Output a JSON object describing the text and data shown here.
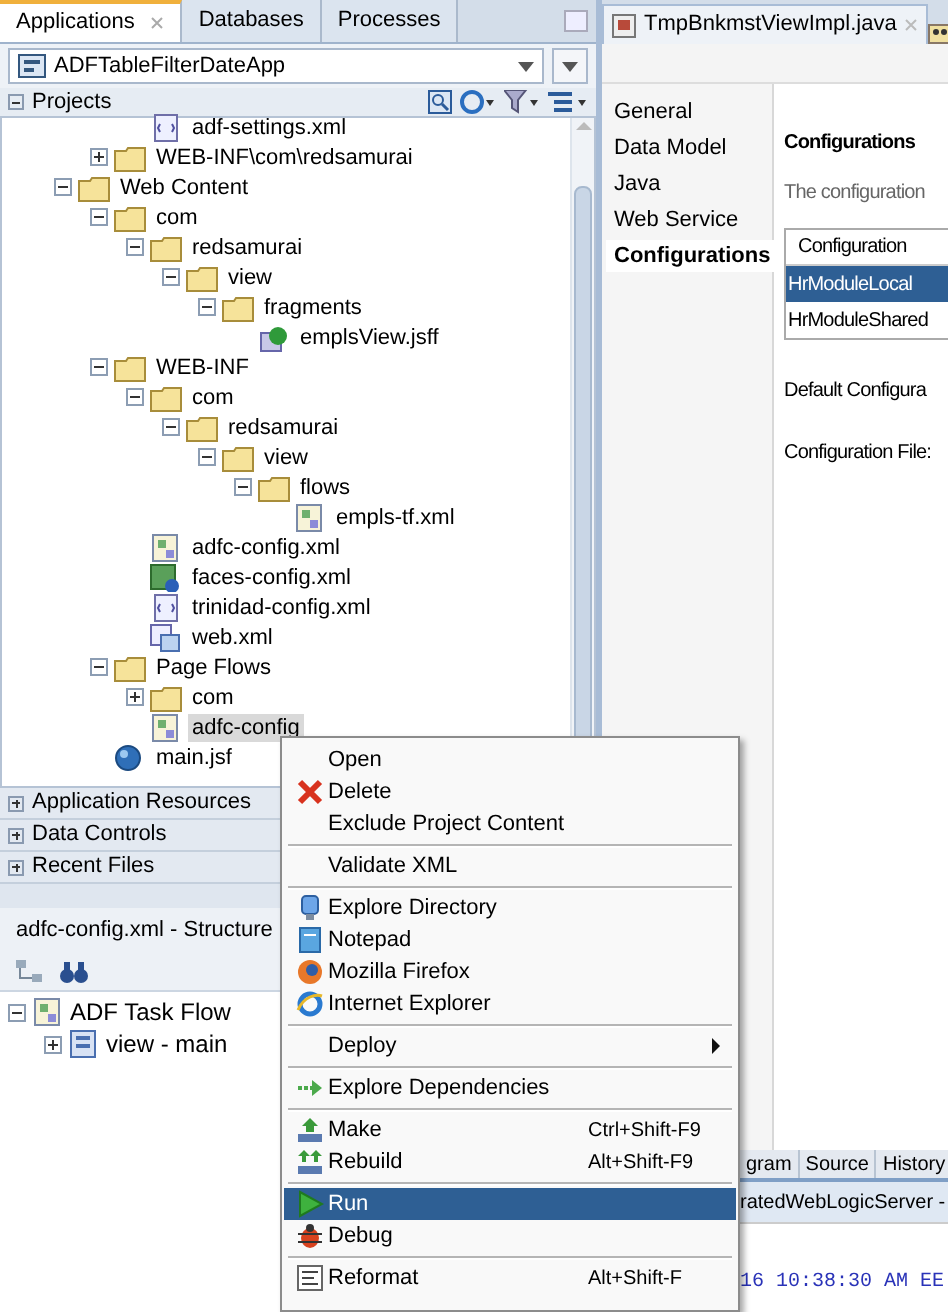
{
  "left_tabs": [
    {
      "label": "Applications",
      "selected": true,
      "closable": true
    },
    {
      "label": "Databases",
      "selected": false,
      "closable": false
    },
    {
      "label": "Processes",
      "selected": false,
      "closable": false
    }
  ],
  "application_selector": {
    "value": "ADFTableFilterDateApp"
  },
  "projects_header": {
    "label": "Projects",
    "expanded": true
  },
  "project_tree": [
    {
      "kind": "branch",
      "children": [
        {
          "kind": "branch",
          "children": [
            {
              "kind": "xml",
              "label": "adf-settings.xml",
              "selected": false
            }
          ]
        },
        {
          "kind": "folder",
          "label": "WEB-INF\\com\\redsamurai",
          "expanded": false,
          "selected": false
        }
      ]
    },
    {
      "kind": "folder",
      "label": "Web Content",
      "expanded": true,
      "selected": false,
      "children": [
        {
          "kind": "folder",
          "label": "com",
          "expanded": true,
          "selected": false,
          "children": [
            {
              "kind": "folder",
              "label": "redsamurai",
              "expanded": true,
              "selected": false,
              "children": [
                {
                  "kind": "folder",
                  "label": "view",
                  "expanded": true,
                  "selected": false,
                  "children": [
                    {
                      "kind": "folder",
                      "label": "fragments",
                      "expanded": true,
                      "selected": false,
                      "children": [
                        {
                          "kind": "page",
                          "label": "emplsView.jsff",
                          "selected": false
                        }
                      ]
                    }
                  ]
                }
              ]
            }
          ]
        },
        {
          "kind": "folder",
          "label": "WEB-INF",
          "expanded": true,
          "selected": false,
          "children": [
            {
              "kind": "folder",
              "label": "com",
              "expanded": true,
              "selected": false,
              "children": [
                {
                  "kind": "folder",
                  "label": "redsamurai",
                  "expanded": true,
                  "selected": false,
                  "children": [
                    {
                      "kind": "folder",
                      "label": "view",
                      "expanded": true,
                      "selected": false,
                      "children": [
                        {
                          "kind": "folder",
                          "label": "flows",
                          "expanded": true,
                          "selected": false,
                          "children": [
                            {
                              "kind": "flow",
                              "label": "empls-tf.xml",
                              "selected": false
                            }
                          ]
                        }
                      ]
                    }
                  ]
                }
              ]
            },
            {
              "kind": "flow",
              "label": "adfc-config.xml",
              "selected": false
            },
            {
              "kind": "faces",
              "label": "faces-config.xml",
              "selected": false
            },
            {
              "kind": "xml",
              "label": "trinidad-config.xml",
              "selected": false
            },
            {
              "kind": "webxml",
              "label": "web.xml",
              "selected": false
            }
          ]
        },
        {
          "kind": "folder",
          "label": "Page Flows",
          "expanded": true,
          "selected": false,
          "children": [
            {
              "kind": "folder",
              "label": "com",
              "expanded": false,
              "selected": false
            },
            {
              "kind": "flow",
              "label": "adfc-config",
              "selected": true
            }
          ]
        },
        {
          "kind": "jsf",
          "label": "main.jsf",
          "selected": false
        }
      ]
    }
  ],
  "accordion": [
    {
      "label": "Application Resources",
      "expanded": false
    },
    {
      "label": "Data Controls",
      "expanded": false
    },
    {
      "label": "Recent Files",
      "expanded": false
    }
  ],
  "structure": {
    "title": "adfc-config.xml - Structure",
    "tree": [
      {
        "kind": "flow",
        "label": "ADF Task Flow",
        "expanded": true,
        "children": [
          {
            "kind": "view",
            "label": "view - main",
            "expanded": false
          }
        ]
      }
    ]
  },
  "editor_tabs": [
    {
      "label": "TmpBnkmstViewImpl.java",
      "selected": true
    }
  ],
  "editor_nav": [
    {
      "label": "General",
      "selected": false
    },
    {
      "label": "Data Model",
      "selected": false
    },
    {
      "label": "Java",
      "selected": false
    },
    {
      "label": "Web Service",
      "selected": false
    },
    {
      "label": "Configurations",
      "selected": true
    }
  ],
  "configurations": {
    "heading": "Configurations",
    "description": "The configuration",
    "column": "Configuration",
    "rows": [
      {
        "name": "HrModuleLocal",
        "selected": true
      },
      {
        "name": "HrModuleShared",
        "selected": false
      }
    ],
    "default_label": "Default Configura",
    "file_label": "Configuration File:"
  },
  "bottom_tabs": [
    {
      "label": "gram",
      "selected": false
    },
    {
      "label": "Source",
      "selected": false
    },
    {
      "label": "History",
      "selected": false
    }
  ],
  "log": {
    "title": "ratedWebLogicServer - ",
    "line": "16 10:38:30 AM EE"
  },
  "context_menu": [
    {
      "kind": "plain",
      "label": "Open"
    },
    {
      "kind": "delete",
      "label": "Delete"
    },
    {
      "kind": "plain",
      "label": "Exclude Project Content"
    },
    {
      "kind": "separator"
    },
    {
      "kind": "plain",
      "label": "Validate XML"
    },
    {
      "kind": "separator"
    },
    {
      "kind": "explore",
      "label": "Explore Directory"
    },
    {
      "kind": "notepad",
      "label": "Notepad"
    },
    {
      "kind": "firefox",
      "label": "Mozilla Firefox"
    },
    {
      "kind": "ie",
      "label": "Internet Explorer"
    },
    {
      "kind": "separator"
    },
    {
      "kind": "plain",
      "label": "Deploy",
      "submenu": true
    },
    {
      "kind": "separator"
    },
    {
      "kind": "dependencies",
      "label": "Explore Dependencies"
    },
    {
      "kind": "separator"
    },
    {
      "kind": "make",
      "label": "Make",
      "shortcut": "Ctrl+Shift-F9"
    },
    {
      "kind": "rebuild",
      "label": "Rebuild",
      "shortcut": "Alt+Shift-F9"
    },
    {
      "kind": "separator"
    },
    {
      "kind": "run",
      "label": "Run",
      "selected": true
    },
    {
      "kind": "debug",
      "label": "Debug"
    },
    {
      "kind": "separator"
    },
    {
      "kind": "reformat",
      "label": "Reformat",
      "shortcut": "Alt+Shift-F"
    }
  ]
}
